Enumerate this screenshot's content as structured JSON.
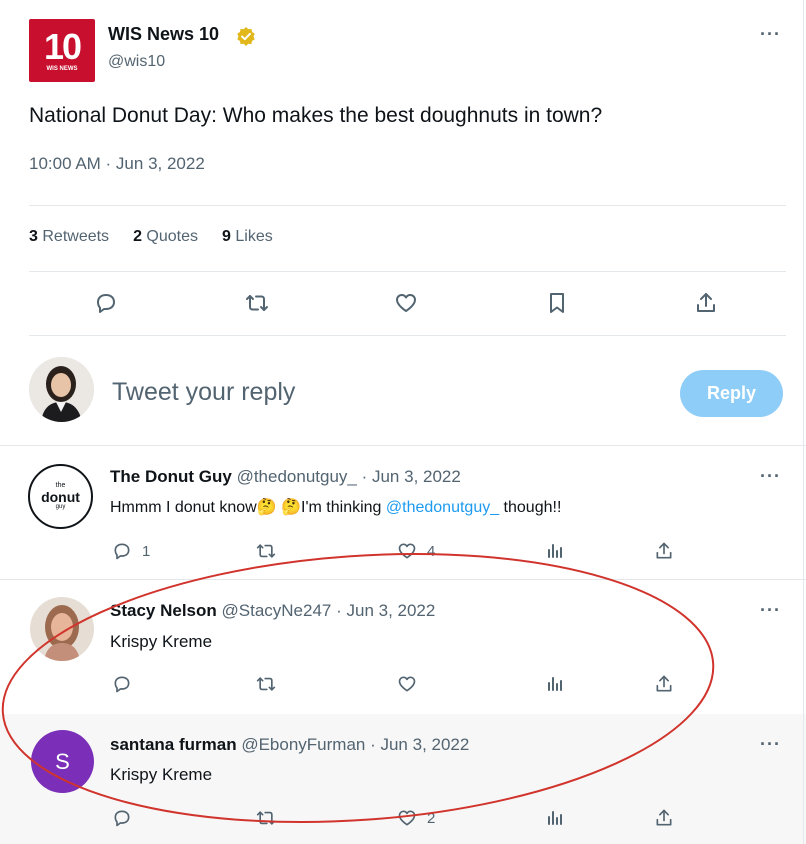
{
  "tweet": {
    "logo_text": "10",
    "logo_subtext": "WIS NEWS",
    "author_name": "WIS News 10",
    "author_handle": "@wis10",
    "text": "National Donut Day: Who makes the best doughnuts in town?",
    "timestamp": "10:00 AM · Jun 3, 2022",
    "stats": {
      "retweets_count": "3",
      "retweets_label": "Retweets",
      "quotes_count": "2",
      "quotes_label": "Quotes",
      "likes_count": "9",
      "likes_label": "Likes"
    },
    "more": "···"
  },
  "composer": {
    "placeholder": "Tweet your reply",
    "reply_button": "Reply"
  },
  "replies": [
    {
      "name": "The Donut Guy",
      "handle": "@thedonutguy_",
      "date": "· Jun 3, 2022",
      "text_before": "Hmmm I donut know",
      "emoji": "🤔 🤔",
      "text_middle": "I'm thinking ",
      "mention": "@thedonutguy_",
      "text_after": " though!!",
      "avatar_top": "the",
      "avatar_main": "donut",
      "avatar_bottom": "guy",
      "reply_count": "1",
      "like_count": "4"
    },
    {
      "name": "Stacy Nelson",
      "handle": "@StacyNe247",
      "date": "· Jun 3, 2022",
      "text": "Krispy Kreme"
    },
    {
      "name": "santana furman",
      "handle": "@EbonyFurman",
      "date": "· Jun 3, 2022",
      "text": "Krispy Kreme",
      "avatar_letter": "S",
      "like_count": "2"
    }
  ],
  "colors": {
    "accent": "#1d9bf0",
    "reply_button_disabled": "#8ecdf8",
    "logo_red": "#c8102e",
    "verified_gold": "#e2b719",
    "avatar_purple": "#7b2fb8",
    "annotation_red": "#d0342c"
  }
}
